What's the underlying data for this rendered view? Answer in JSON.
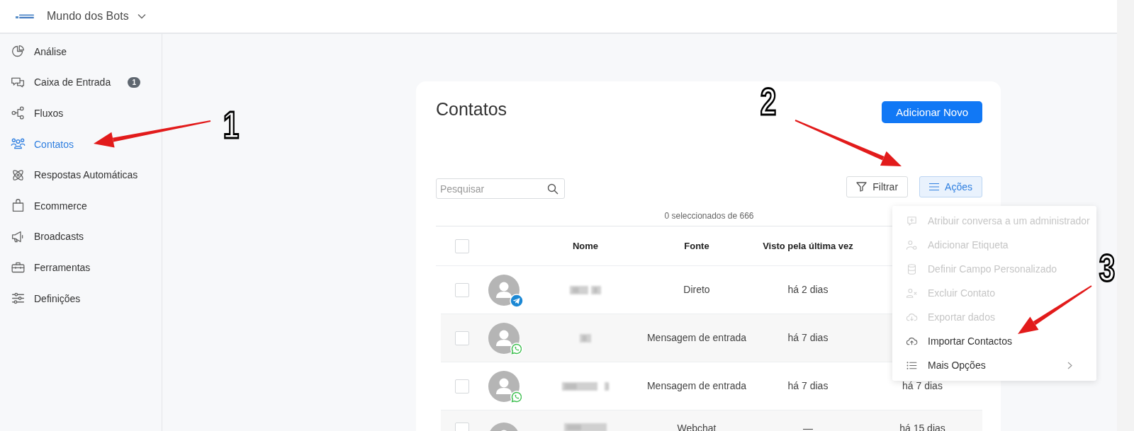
{
  "header": {
    "workspace": "Mundo dos Bots"
  },
  "sidebar": {
    "items": [
      {
        "label": "Análise",
        "selected": false
      },
      {
        "label": "Caixa de Entrada",
        "badge": "1",
        "selected": false
      },
      {
        "label": "Fluxos",
        "selected": false
      },
      {
        "label": "Contatos",
        "selected": true
      },
      {
        "label": "Respostas Automáticas",
        "selected": false
      },
      {
        "label": "Ecommerce",
        "selected": false
      },
      {
        "label": "Broadcasts",
        "selected": false
      },
      {
        "label": "Ferramentas",
        "selected": false
      },
      {
        "label": "Definições",
        "selected": false
      }
    ]
  },
  "contacts": {
    "title": "Contatos",
    "add_button": "Adicionar Novo",
    "search": {
      "placeholder": "Pesquisar"
    },
    "filter_button": "Filtrar",
    "actions_button": {
      "label": "Ações",
      "expanded": true
    },
    "selection_count": "0 seleccionados de 666",
    "table": {
      "select_all": false,
      "columns": [
        "Nome",
        "Fonte",
        "Visto pela última vez"
      ],
      "rows": [
        {
          "kind": "telegram",
          "checked": false,
          "source": "Direto",
          "last_seen": "há 2 dias"
        },
        {
          "kind": "whatsapp",
          "checked": false,
          "source": "Mensagem de entrada",
          "last_seen": "há 7 dias"
        },
        {
          "kind": "whatsapp",
          "checked": false,
          "source": "Mensagem de entrada",
          "last_seen": "há 7 dias",
          "column_5": "há 7 dias"
        },
        {
          "kind": "plain",
          "checked": false,
          "source": "Webchat",
          "last_seen": "—",
          "column_5": "há 15 dias"
        }
      ]
    }
  },
  "actions_menu": {
    "items": [
      {
        "label": "Atribuir conversa a um administrador",
        "disabled": true
      },
      {
        "label": "Adicionar Etiqueta",
        "disabled": true
      },
      {
        "label": "Definir Campo Personalizado",
        "disabled": true
      },
      {
        "label": "Excluir Contato",
        "disabled": true
      },
      {
        "label": "Exportar dados",
        "disabled": true
      },
      {
        "label": "Importar Contactos",
        "disabled": false
      },
      {
        "label": "Mais Opções",
        "disabled": false,
        "submenu": true
      }
    ]
  },
  "annotations": [
    {
      "label": "1"
    },
    {
      "label": "2"
    },
    {
      "label": "3"
    }
  ]
}
